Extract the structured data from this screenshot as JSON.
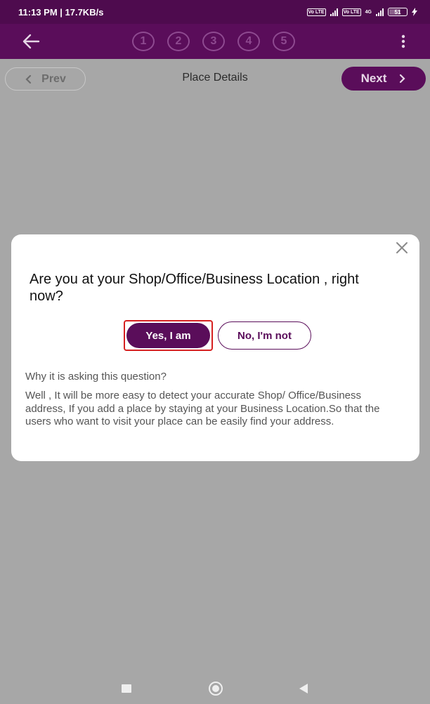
{
  "status_bar": {
    "time_speed": "11:13 PM | 17.7KB/s",
    "volte_label": "Vo LTE",
    "network_label": "4G",
    "battery": "51"
  },
  "app_bar": {
    "steps": [
      "1",
      "2",
      "3",
      "4",
      "5"
    ]
  },
  "nav": {
    "prev_label": "Prev",
    "title": "Place Details",
    "next_label": "Next"
  },
  "dialog": {
    "question": "Are you at your Shop/Office/Business Location , right now?",
    "yes_label": "Yes, I am",
    "no_label": "No, I'm not",
    "why_heading": "Why it is asking this question?",
    "why_text": "Well , It will be more easy to detect your accurate Shop/ Office/Business address, If you add a place by staying at your Business Location.So that the users who want to visit your place can be easily find your address."
  },
  "colors": {
    "brand": "#5a0d5a",
    "status_bar": "#4e0b4e",
    "overlay": "#a7a7a7",
    "highlight": "#d62020"
  }
}
